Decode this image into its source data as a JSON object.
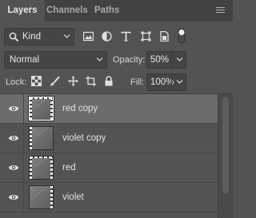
{
  "tabs": [
    {
      "label": "Layers",
      "active": true
    },
    {
      "label": "Channels",
      "active": false
    },
    {
      "label": "Paths",
      "active": false
    }
  ],
  "filter": {
    "kind_label": "Kind",
    "icons": [
      "pixel-layer-filter-icon",
      "adjustment-layer-filter-icon",
      "type-layer-filter-icon",
      "shape-layer-filter-icon",
      "smart-object-filter-icon",
      "filter-toggle-icon"
    ]
  },
  "blend": {
    "mode": "Normal",
    "opacity_label": "Opacity:",
    "opacity_value": "50%"
  },
  "lock": {
    "label": "Lock:",
    "icons": [
      "lock-transparent-pixels-icon",
      "lock-image-pixels-icon",
      "lock-position-icon",
      "lock-artboard-icon",
      "lock-all-icon"
    ],
    "fill_label": "Fill:",
    "fill_value": "100%"
  },
  "layers": [
    {
      "name": "red copy",
      "selected": true,
      "visible": true
    },
    {
      "name": "violet copy",
      "selected": false,
      "visible": true
    },
    {
      "name": "red",
      "selected": false,
      "visible": true
    },
    {
      "name": "violet",
      "selected": false,
      "visible": true
    }
  ],
  "colors": {
    "panel_bg": "#535353",
    "tabbar_bg": "#424242",
    "selected_row": "#6c6c6c",
    "field_bg": "#454545"
  }
}
